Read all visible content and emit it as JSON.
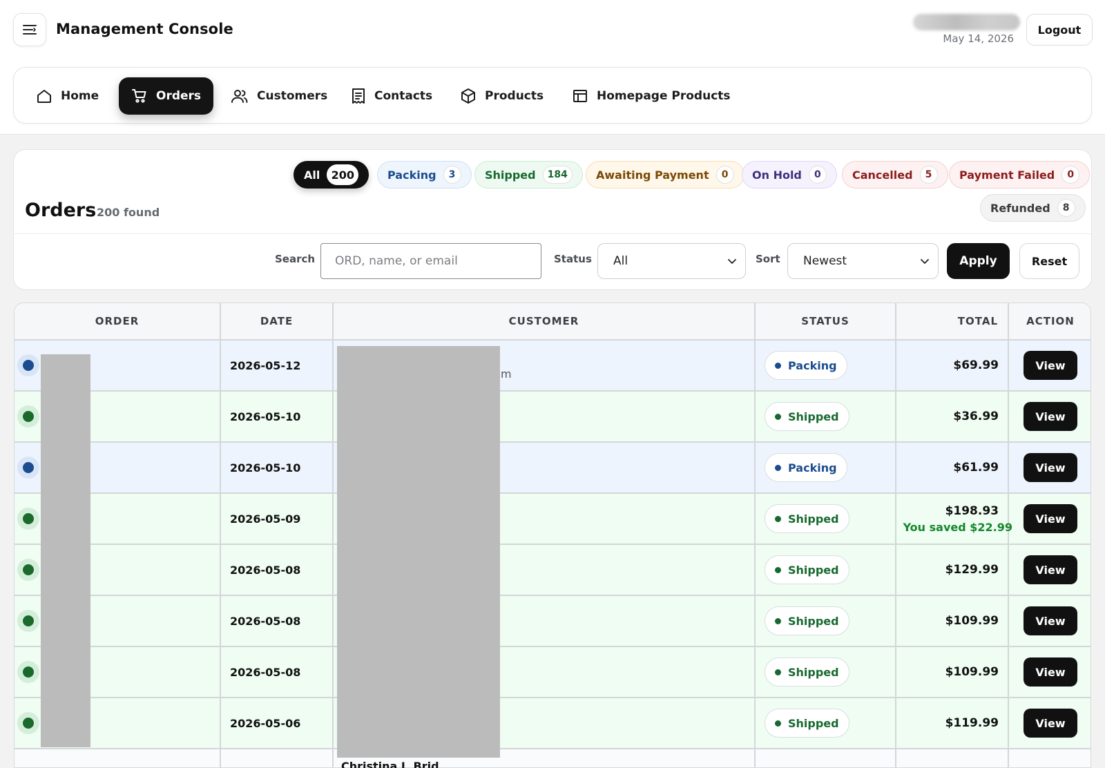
{
  "header": {
    "title": "Management Console",
    "date": "May 14, 2026",
    "logout_label": "Logout"
  },
  "nav": {
    "items": [
      {
        "label": "Home",
        "icon": "home-icon"
      },
      {
        "label": "Orders",
        "icon": "cart-icon",
        "active": true
      },
      {
        "label": "Customers",
        "icon": "users-icon"
      },
      {
        "label": "Contacts",
        "icon": "receipt-icon"
      },
      {
        "label": "Products",
        "icon": "box-icon"
      },
      {
        "label": "Homepage Products",
        "icon": "layout-icon"
      }
    ]
  },
  "status_filters": [
    {
      "label": "All",
      "count": "200",
      "active": true
    },
    {
      "label": "Packing",
      "count": "3"
    },
    {
      "label": "Shipped",
      "count": "184"
    },
    {
      "label": "Awaiting Payment",
      "count": "0"
    },
    {
      "label": "On Hold",
      "count": "0"
    },
    {
      "label": "Cancelled",
      "count": "5"
    },
    {
      "label": "Payment Failed",
      "count": "0"
    },
    {
      "label": "Refunded",
      "count": "8"
    }
  ],
  "orders": {
    "heading": "Orders",
    "found": "200 found"
  },
  "filters": {
    "search_label": "Search",
    "search_placeholder": "ORD, name, or email",
    "status_label": "Status",
    "status_value": "All",
    "sort_label": "Sort",
    "sort_value": "Newest",
    "apply_label": "Apply",
    "reset_label": "Reset"
  },
  "table": {
    "columns": [
      "ORDER",
      "DATE",
      "CUSTOMER",
      "STATUS",
      "TOTAL",
      "ACTION"
    ],
    "rows": [
      {
        "date": "2026-05-12",
        "status": "Packing",
        "total": "$69.99",
        "action": "View"
      },
      {
        "date": "2026-05-10",
        "status": "Shipped",
        "total": "$36.99",
        "action": "View"
      },
      {
        "date": "2026-05-10",
        "status": "Packing",
        "total": "$61.99",
        "action": "View"
      },
      {
        "date": "2026-05-09",
        "status": "Shipped",
        "total": "$198.93",
        "saved": "You saved $22.99",
        "action": "View"
      },
      {
        "date": "2026-05-08",
        "status": "Shipped",
        "total": "$129.99",
        "action": "View"
      },
      {
        "date": "2026-05-08",
        "status": "Shipped",
        "total": "$109.99",
        "action": "View"
      },
      {
        "date": "2026-05-08",
        "status": "Shipped",
        "total": "$109.99",
        "action": "View"
      },
      {
        "date": "2026-05-06",
        "status": "Shipped",
        "total": "$119.99",
        "action": "View"
      }
    ],
    "customer_fragment": "m",
    "next_customer_partial": "Christina I. Brid"
  },
  "colors": {
    "accent": "#111111",
    "packing": "#1b4c8f",
    "shipped": "#17692f",
    "saved": "#15862c"
  }
}
